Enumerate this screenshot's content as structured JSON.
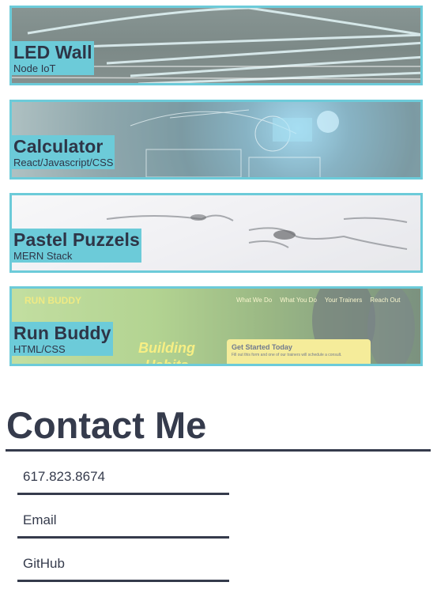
{
  "projects": [
    {
      "title": "LED Wall",
      "stack": "Node IoT"
    },
    {
      "title": "Calculator",
      "stack": "React/Javascript/CSS"
    },
    {
      "title": "Pastel Puzzels",
      "stack": "MERN Stack"
    },
    {
      "title": "Run Buddy",
      "stack": "HTML/CSS",
      "preview": {
        "logo": "RUN BUDDY",
        "nav": [
          "What We Do",
          "What You Do",
          "Your Trainers",
          "Reach Out"
        ],
        "hero": "Building Habits",
        "card_title": "Get Started Today",
        "card_text": "Fill out this form and one of our trainers will schedule a consult."
      }
    }
  ],
  "contact": {
    "title": "Contact Me",
    "items": [
      "617.823.8674",
      "Email",
      "GitHub"
    ]
  },
  "colors": {
    "accent": "#6ccbd9",
    "text": "#353b4c"
  }
}
